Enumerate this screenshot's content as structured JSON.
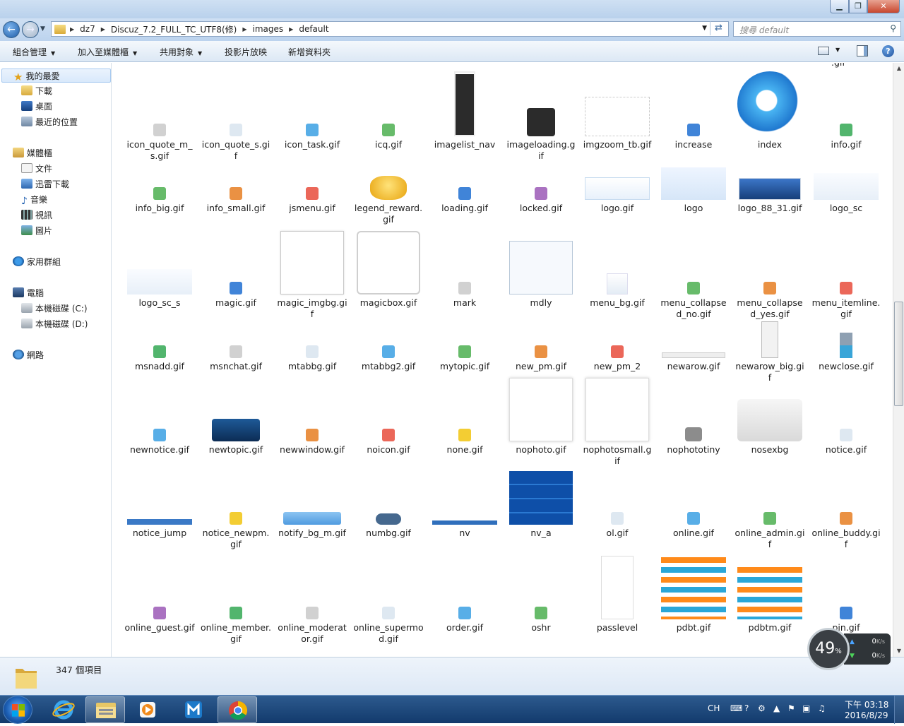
{
  "address": {
    "segments": [
      "dz7",
      "Discuz_7.2_FULL_TC_UTF8(修)",
      "images",
      "default"
    ],
    "search_placeholder": "搜尋 default"
  },
  "toolbar": {
    "organize": "組合管理",
    "add_to_library": "加入至媒體櫃",
    "share": "共用對象",
    "slideshow": "投影片放映",
    "new_folder": "新增資料夾"
  },
  "navpane": {
    "favorites": "我的最愛",
    "downloads": "下載",
    "desktop": "桌面",
    "recent": "最近的位置",
    "libraries": "媒體櫃",
    "documents": "文件",
    "thunder": "迅雷下載",
    "music": "音樂",
    "videos": "視訊",
    "pictures": "圖片",
    "homegroup": "家用群組",
    "computer": "電腦",
    "drive_c": "本機磁碟 (C:)",
    "drive_d": "本機磁碟 (D:)",
    "network": "網路"
  },
  "files": [
    [
      "icon_quote_m_s.gif",
      "icon_quote_s.gif",
      "icon_task.gif",
      "icq.gif",
      "imagelist_nav",
      "imageloading.gif",
      "imgzoom_tb.gif",
      "increase",
      "index",
      "info.gif"
    ],
    [
      "info_big.gif",
      "info_small.gif",
      "jsmenu.gif",
      "legend_reward.gif",
      "loading.gif",
      "locked.gif",
      "logo.gif",
      "logo",
      "logo_88_31.gif",
      "logo_sc"
    ],
    [
      "logo_sc_s",
      "magic.gif",
      "magic_imgbg.gif",
      "magicbox.gif",
      "mark",
      "mdly",
      "menu_bg.gif",
      "menu_collapsed_no.gif",
      "menu_collapsed_yes.gif",
      "menu_itemline.gif"
    ],
    [
      "msnadd.gif",
      "msnchat.gif",
      "mtabbg.gif",
      "mtabbg2.gif",
      "mytopic.gif",
      "new_pm.gif",
      "new_pm_2",
      "newarow.gif",
      "newarow_big.gif",
      "newclose.gif"
    ],
    [
      "newnotice.gif",
      "newtopic.gif",
      "newwindow.gif",
      "noicon.gif",
      "none.gif",
      "nophoto.gif",
      "nophotosmall.gif",
      "nophototiny",
      "nosexbg",
      "notice.gif"
    ],
    [
      "notice_jump",
      "notice_newpm.gif",
      "notify_bg_m.gif",
      "numbg.gif",
      "nv",
      "nv_a",
      "ol.gif",
      "online.gif",
      "online_admin.gif",
      "online_buddy.gif"
    ],
    [
      "online_guest.gif",
      "online_member.gif",
      "online_moderator.gif",
      "online_supermod.gif",
      "order.gif",
      "oshr",
      "passlevel",
      "pdbt.gif",
      "pdbtm.gif",
      "pin.gif"
    ]
  ],
  "top_cut_labels": [
    ".gif"
  ],
  "status": {
    "count": "347 個項目"
  },
  "netmonitor": {
    "cpu": "49",
    "cpu_unit": "%",
    "up": "0",
    "down": "0",
    "unit": "K/s"
  },
  "tray": {
    "lang": "CH",
    "time": "下午 03:18",
    "date": "2016/8/29"
  },
  "colors": {
    "selection": "#d9e9fb",
    "taskbar": "#1d4a80",
    "accent": "#1f6fd1"
  }
}
